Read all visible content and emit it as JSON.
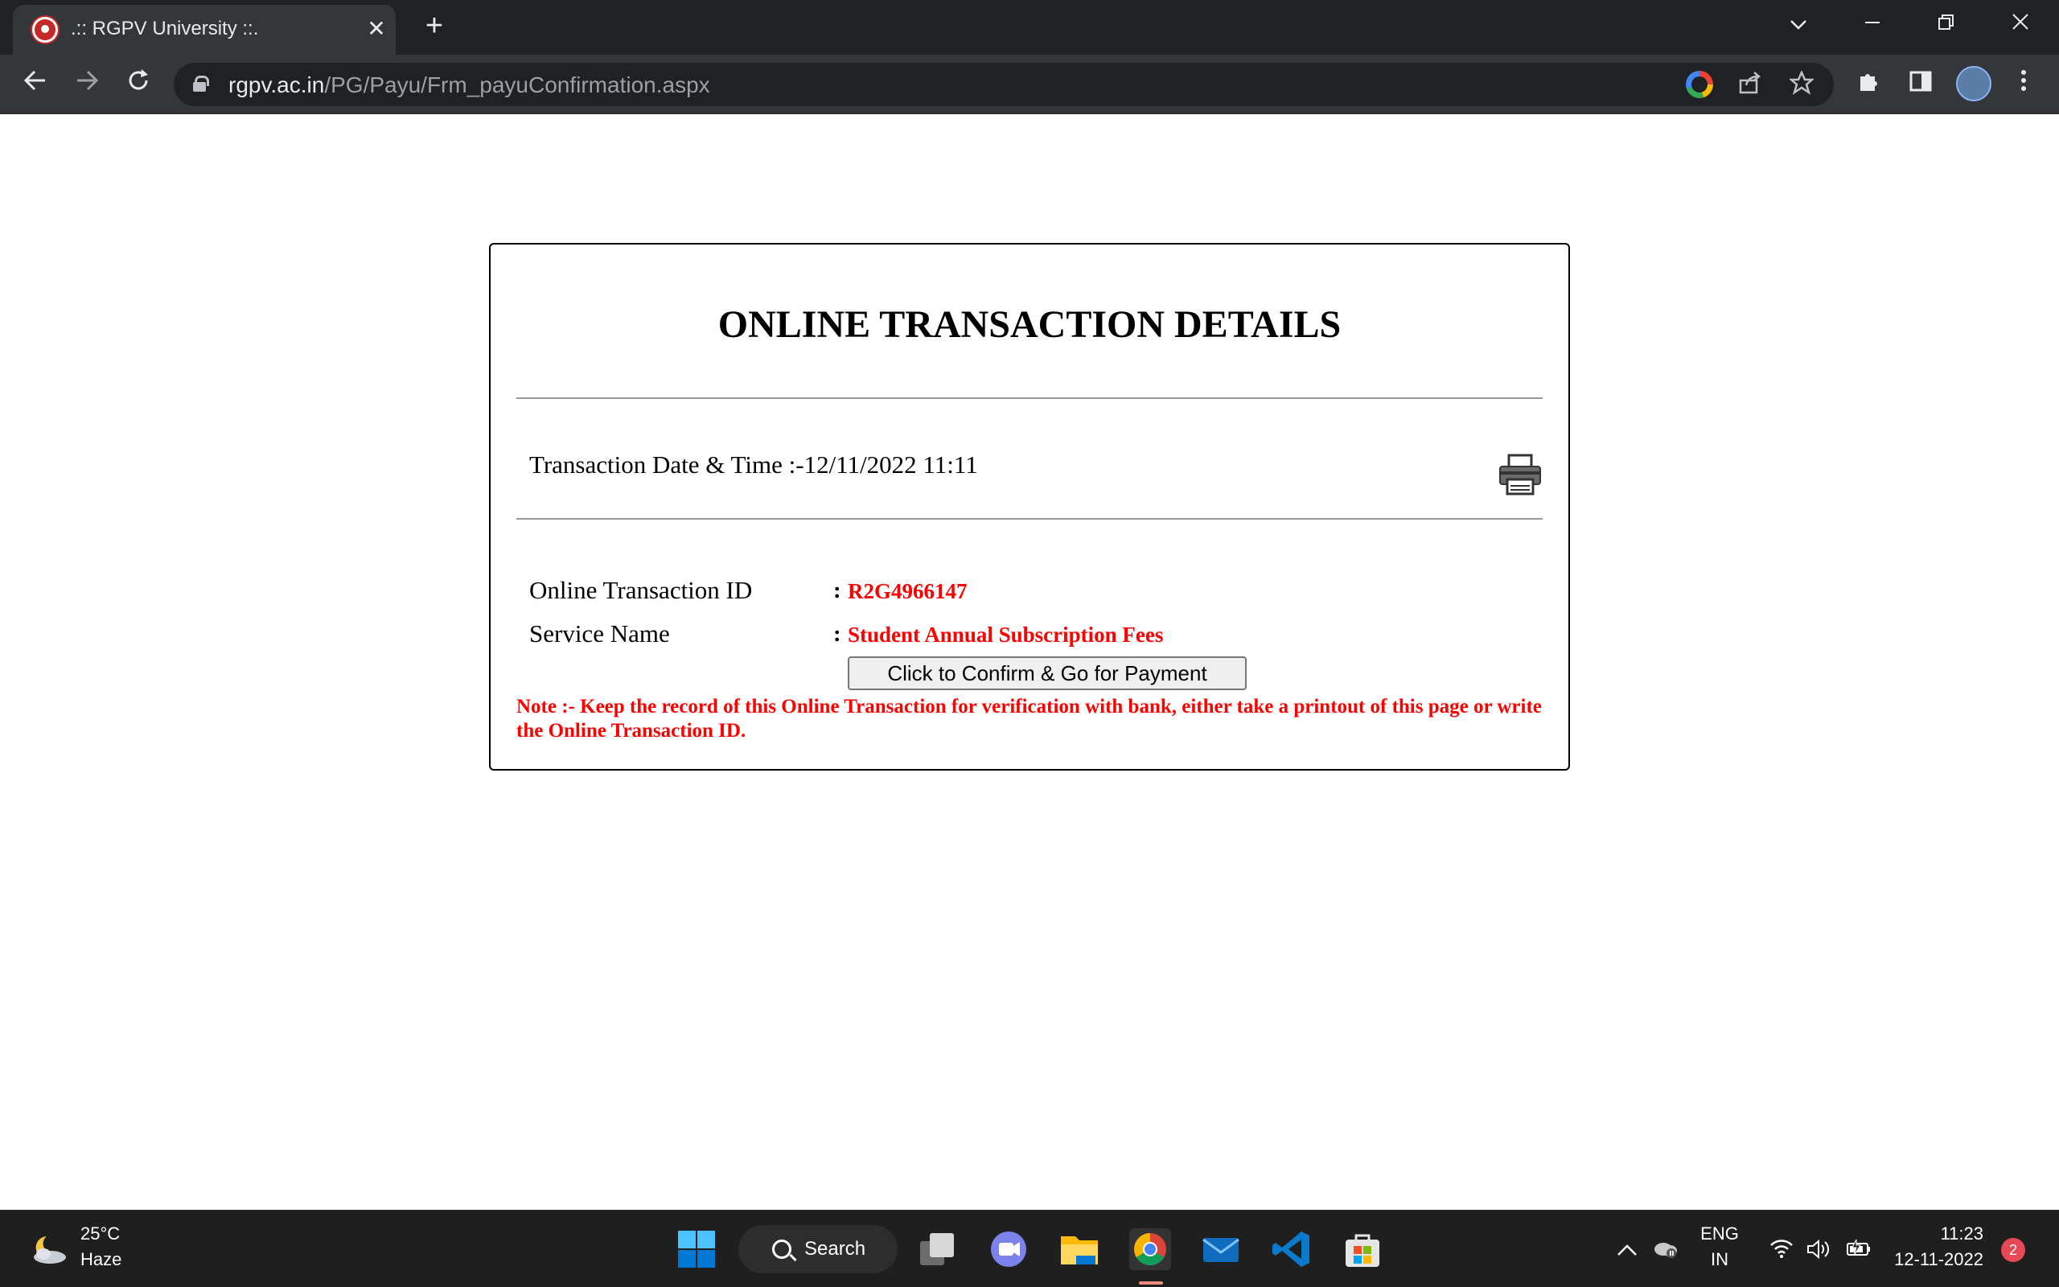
{
  "browser": {
    "tab_title": ".:: RGPV University ::.",
    "new_tab_glyph": "+",
    "close_glyph": "✕",
    "url_host": "rgpv.ac.in",
    "url_path": "/PG/Payu/Frm_payuConfirmation.aspx"
  },
  "page": {
    "heading": "ONLINE TRANSACTION DETAILS",
    "date_line": "Transaction Date & Time :-12/11/2022 11:11",
    "transaction_id_label": "Online Transaction ID",
    "transaction_id_colon": ":",
    "transaction_id_value": "R2G4966147",
    "service_label": "Service Name",
    "service_colon": ":",
    "service_value": "Student Annual Subscription Fees",
    "confirm_button": "Click to Confirm & Go for Payment",
    "note": "Note :- Keep the record of this Online Transaction for verification with bank, either take a printout of this page or write the Online Transaction ID.",
    "accent_color": "#ff0000"
  },
  "taskbar": {
    "weather_temp": "25°C",
    "weather_desc": "Haze",
    "search_label": "Search",
    "language_top": "ENG",
    "language_bottom": "IN",
    "time": "11:23",
    "date": "12-11-2022",
    "notification_count": "2",
    "apps": [
      "start-icon",
      "task-view-icon",
      "teams-chat-icon",
      "file-explorer-icon",
      "chrome-icon",
      "mail-icon",
      "vscode-icon",
      "microsoft-store-icon"
    ]
  }
}
